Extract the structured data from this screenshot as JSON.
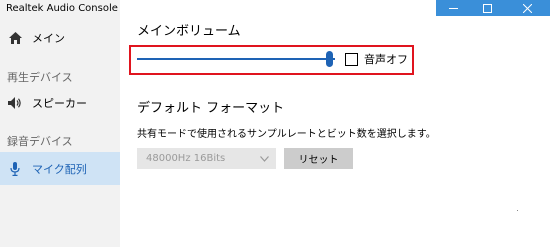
{
  "app_title": "Realtek Audio Console",
  "sidebar": {
    "home_label": "メイン",
    "playback_section": "再生デバイス",
    "speaker_label": "スピーカー",
    "recording_section": "録音デバイス",
    "mic_label": "マイク配列"
  },
  "main_volume": {
    "title": "メインボリューム",
    "level": 0.97,
    "mute_label": "音声オフ",
    "muted": false
  },
  "default_format": {
    "title": "デフォルト フォーマット",
    "description": "共有モードで使用されるサンプルレートとビット数を選択します。",
    "selected": "48000Hz 16Bits",
    "reset_label": "リセット"
  },
  "colors": {
    "accent": "#1e63b5",
    "highlight_border": "#e0141e",
    "selected_nav": "#cfe3f5",
    "titlebar_buttons": "#3a8fd9"
  },
  "icons": [
    "home-icon",
    "speaker-icon",
    "microphone-icon",
    "minimize-icon",
    "maximize-icon",
    "close-icon",
    "chevron-down-icon"
  ]
}
